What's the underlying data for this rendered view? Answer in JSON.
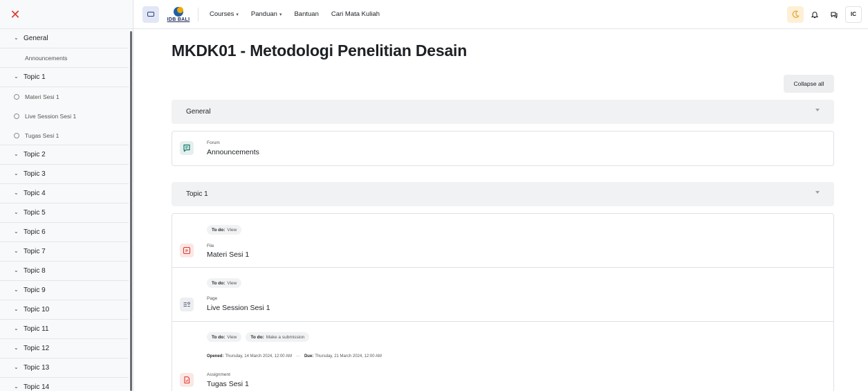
{
  "drawer": {
    "close_icon": "close-icon",
    "general": {
      "label": "General",
      "items": [
        "Announcements"
      ]
    },
    "topic1": {
      "label": "Topic 1",
      "items": [
        "Materi Sesi 1",
        "Live Session Sesi 1",
        "Tugas Sesi 1"
      ]
    },
    "topics": [
      "Topic 2",
      "Topic 3",
      "Topic 4",
      "Topic 5",
      "Topic 6",
      "Topic 7",
      "Topic 8",
      "Topic 9",
      "Topic 10",
      "Topic 11",
      "Topic 12",
      "Topic 13",
      "Topic 14"
    ]
  },
  "navbar": {
    "logo_text": "IDB BALI",
    "menu": [
      "Courses",
      "Panduan",
      "Bantuan",
      "Cari Mata Kuliah"
    ],
    "avatar_initials": "IC"
  },
  "main": {
    "title": "MKDK01 - Metodologi Penelitian Desain",
    "collapse_label": "Collapse all",
    "general_section": "General",
    "forum": {
      "type": "Forum",
      "name": "Announcements"
    },
    "topic1_section": "Topic 1",
    "file": {
      "todo": "To do:",
      "todo_action": "View",
      "type": "File",
      "name": "Materi Sesi 1"
    },
    "page": {
      "todo": "To do:",
      "todo_action": "View",
      "type": "Page",
      "name": "Live Session Sesi 1"
    },
    "assignment": {
      "todo1": "To do:",
      "todo1_action": "View",
      "todo2": "To do:",
      "todo2_action": "Make a submission",
      "opened_label": "Opened:",
      "opened_value": "Thursday, 14 March 2024, 12:00 AM",
      "due_label": "Due:",
      "due_value": "Thursday, 21 March 2024, 12:00 AM",
      "separator": "···",
      "type": "Assignment",
      "name": "Tugas Sesi 1"
    }
  },
  "colors": {
    "close": "#e0372f",
    "accent": "#1f5fa8",
    "logo_orange": "#f2a900",
    "forum_icon": "#0f7a6b",
    "file_icon": "#e0372f"
  }
}
